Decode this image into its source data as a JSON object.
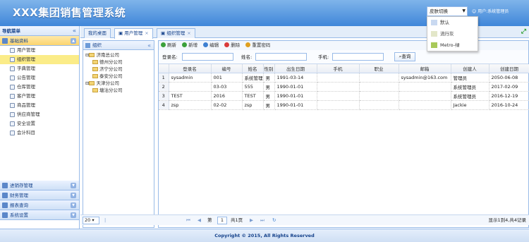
{
  "header": {
    "title": "XXX集团销售管理系统",
    "theme_select": "皮肤切换",
    "user_label": "用户:系统管理员",
    "theme_options": [
      {
        "label": "默认",
        "color": "#c9d9f1"
      },
      {
        "label": "流行灰",
        "color": "#e3e7c9"
      },
      {
        "label": "Metro-绿",
        "color": "#a9c95a"
      }
    ]
  },
  "sidebar": {
    "title": "导航菜单",
    "active_group": "基础资料",
    "items": [
      "用户管理",
      "组织管理",
      "字典管理",
      "公告管理",
      "仓库管理",
      "客户管理",
      "商品管理",
      "供应商管理",
      "安全设置",
      "会计科目"
    ],
    "selected_item": "组织管理",
    "groups": [
      "进销存管理",
      "财务管理",
      "报表查询",
      "系统设置"
    ]
  },
  "tabs": [
    {
      "label": "我的桌面",
      "closable": false
    },
    {
      "label": "用户管理",
      "closable": true
    },
    {
      "label": "组织管理",
      "closable": true
    }
  ],
  "org_panel": {
    "title": "组织",
    "tree": [
      {
        "label": "济南总公司",
        "level": 0
      },
      {
        "label": "德州分公司",
        "level": 1
      },
      {
        "label": "济宁分公司",
        "level": 1
      },
      {
        "label": "泰安分公司",
        "level": 1
      },
      {
        "label": "天津分公司",
        "level": 0
      },
      {
        "label": "塘沽分公司",
        "level": 1
      }
    ]
  },
  "toolbar": {
    "buttons": [
      {
        "label": "刷新",
        "color": "#3aa03a"
      },
      {
        "label": "新增",
        "color": "#3aa03a"
      },
      {
        "label": "编辑",
        "color": "#3d7fd1"
      },
      {
        "label": "删除",
        "color": "#d93a3a"
      },
      {
        "label": "重置密码",
        "color": "#e0a020"
      }
    ]
  },
  "search": {
    "login_label": "登录名:",
    "name_label": "姓名:",
    "phone_label": "手机:",
    "button": "查询"
  },
  "table": {
    "columns": [
      "登录名",
      "编号",
      "姓名",
      "性别",
      "出生日期",
      "手机",
      "职业",
      "邮箱",
      "创建人",
      "创建日期"
    ],
    "rows": [
      [
        "1",
        "sysadmin",
        "001",
        "系统管理员",
        "男",
        "1991-03-14",
        "",
        "",
        "sysadmin@163.com",
        "管理员",
        "2050-06-08"
      ],
      [
        "2",
        "",
        "03-03",
        "555",
        "男",
        "1990-01-01",
        "",
        "",
        "",
        "系统管理员",
        "2017-02-09"
      ],
      [
        "3",
        "TEST",
        "2016",
        "TEST",
        "男",
        "1990-01-01",
        "",
        "",
        "",
        "系统管理员",
        "2016-12-19"
      ],
      [
        "4",
        "zsp",
        "02-02",
        "zsp",
        "男",
        "1990-01-01",
        "",
        "",
        "",
        "Jackie",
        "2016-10-24"
      ]
    ]
  },
  "pager": {
    "page_size": "20",
    "page_prefix": "第",
    "page_value": "1",
    "page_suffix": "共1页",
    "summary": "显示1到4,共4记录"
  },
  "footer": {
    "text": "Copyright © 2015, All Rights Reserved"
  }
}
